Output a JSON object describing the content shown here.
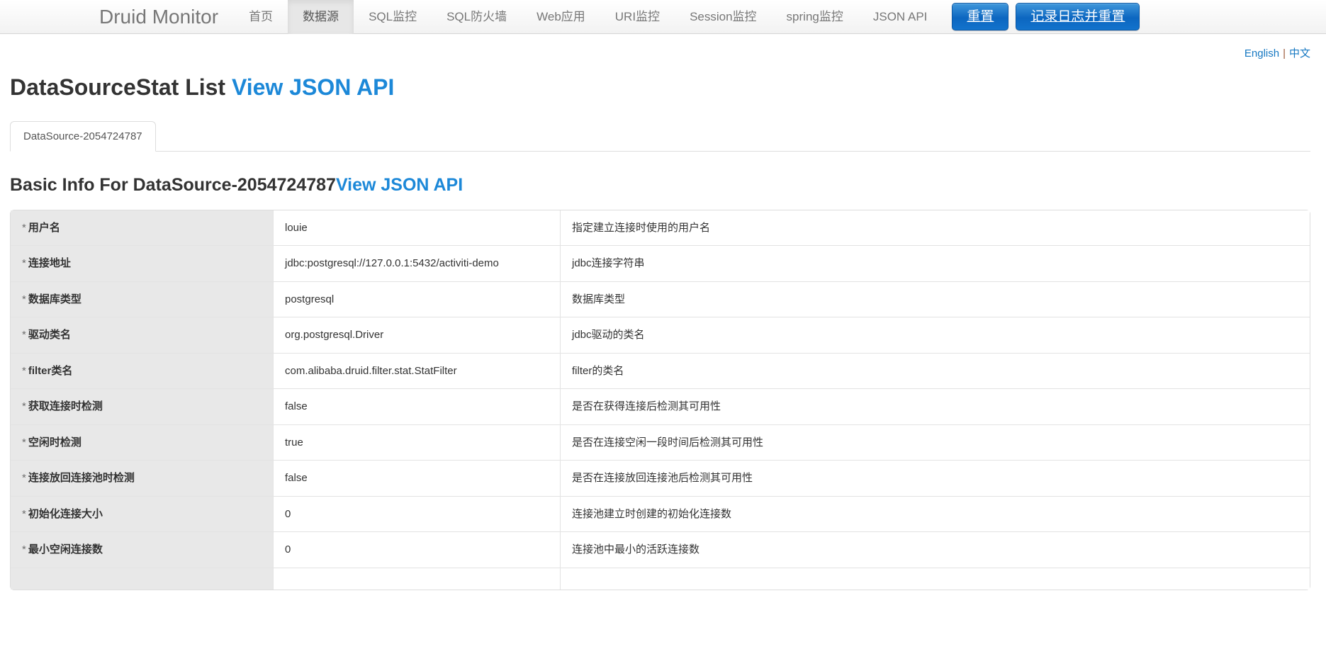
{
  "navbar": {
    "brand": "Druid Monitor",
    "items": [
      {
        "label": "首页",
        "active": false
      },
      {
        "label": "数据源",
        "active": true
      },
      {
        "label": "SQL监控",
        "active": false
      },
      {
        "label": "SQL防火墙",
        "active": false
      },
      {
        "label": "Web应用",
        "active": false
      },
      {
        "label": "URI监控",
        "active": false
      },
      {
        "label": "Session监控",
        "active": false
      },
      {
        "label": "spring监控",
        "active": false
      },
      {
        "label": "JSON API",
        "active": false
      }
    ],
    "buttons": [
      {
        "label": "重置",
        "name": "reset-button"
      },
      {
        "label": "记录日志并重置",
        "name": "log-and-reset-button"
      }
    ],
    "accent_color": "#0c66c0"
  },
  "language_bar": {
    "english": "English",
    "separator": "|",
    "chinese": "中文"
  },
  "page": {
    "title_text": "DataSourceStat List ",
    "title_link": "View JSON API",
    "section_title_text": "Basic Info For DataSource-2054724787",
    "section_title_link": "View JSON API"
  },
  "tabs": [
    {
      "label": "DataSource-2054724787",
      "active": true
    }
  ],
  "table": {
    "rows": [
      {
        "label": "用户名",
        "value": "louie",
        "desc": "指定建立连接时使用的用户名"
      },
      {
        "label": "连接地址",
        "value": "jdbc:postgresql://127.0.0.1:5432/activiti-demo",
        "desc": "jdbc连接字符串"
      },
      {
        "label": "数据库类型",
        "value": "postgresql",
        "desc": "数据库类型"
      },
      {
        "label": "驱动类名",
        "value": "org.postgresql.Driver",
        "desc": "jdbc驱动的类名"
      },
      {
        "label": "filter类名",
        "value": "com.alibaba.druid.filter.stat.StatFilter",
        "desc": "filter的类名"
      },
      {
        "label": "获取连接时检测",
        "value": "false",
        "desc": "是否在获得连接后检测其可用性"
      },
      {
        "label": "空闲时检测",
        "value": "true",
        "desc": "是否在连接空闲一段时间后检测其可用性"
      },
      {
        "label": "连接放回连接池时检测",
        "value": "false",
        "desc": "是否在连接放回连接池后检测其可用性"
      },
      {
        "label": "初始化连接大小",
        "value": "0",
        "desc": "连接池建立时创建的初始化连接数"
      },
      {
        "label": "最小空闲连接数",
        "value": "0",
        "desc": "连接池中最小的活跃连接数"
      },
      {
        "label": "",
        "value": "",
        "desc": ""
      }
    ],
    "required_marker": "*"
  }
}
